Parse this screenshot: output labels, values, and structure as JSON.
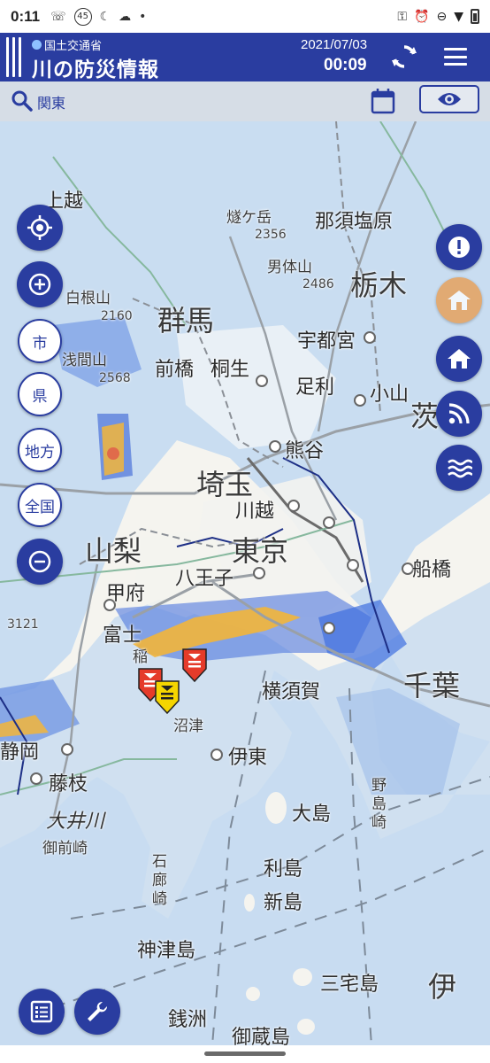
{
  "status_bar": {
    "time": "0:11",
    "speed_badge": "45",
    "icons": [
      "wifi-calling-icon",
      "speed-badge-icon",
      "moon-icon",
      "cloud-icon",
      "dot-icon",
      "vpn-key-icon",
      "alarm-icon",
      "do-not-disturb-icon",
      "wifi-icon",
      "battery-icon"
    ]
  },
  "header": {
    "ministry": "国土交通省",
    "app_title": "川の防災情報",
    "date": "2021/07/03",
    "time": "00:09",
    "icons": [
      "refresh-icon",
      "menu-icon"
    ],
    "color": "#2a3da0"
  },
  "search": {
    "region": "関東",
    "icons": [
      "search-icon",
      "calendar-icon",
      "eye-icon"
    ]
  },
  "map_controls": {
    "left": {
      "location_icon": "locate-icon",
      "zoom_in_icon": "plus-icon",
      "city_label": "市",
      "pref_label": "県",
      "region_label": "地方",
      "nation_label": "全国",
      "zoom_out_icon": "minus-icon"
    },
    "right": [
      "alert-icon",
      "shelter-icon",
      "home-icon",
      "rss-icon",
      "water-icon"
    ],
    "bottom": [
      "list-icon",
      "wrench-icon"
    ]
  },
  "map_labels": {
    "prefectures": [
      "群馬",
      "栃木",
      "埼玉",
      "山梨",
      "東京",
      "千葉",
      "茨",
      "伊"
    ],
    "cities": [
      "上越",
      "那須塩原",
      "宇都宮",
      "前橋",
      "桐生",
      "足利",
      "熊谷",
      "川越",
      "八王子",
      "甲府",
      "富士",
      "横須賀",
      "伊東",
      "大島",
      "静岡",
      "藤枝",
      "利島",
      "新島",
      "神津島",
      "三宅島",
      "御蔵島",
      "銭洲",
      "小山",
      "船橋"
    ],
    "small": [
      "白根山",
      "浅間山",
      "男体山",
      "燧ケ岳",
      "御前崎",
      "石廊崎",
      "野島崎",
      "沼津",
      "稲"
    ],
    "rivers": [
      "大井川"
    ],
    "elevations": [
      "2356",
      "2486",
      "2160",
      "2568",
      "3121"
    ]
  },
  "warning_markers": {
    "red_count": 2,
    "yellow_count": 1,
    "colors": {
      "red": "#e53b2a",
      "yellow": "#f5d500",
      "rain_light": "#a8cdf3",
      "rain_mid": "#3f6fe0",
      "rain_heavy": "#f2b53a"
    }
  }
}
